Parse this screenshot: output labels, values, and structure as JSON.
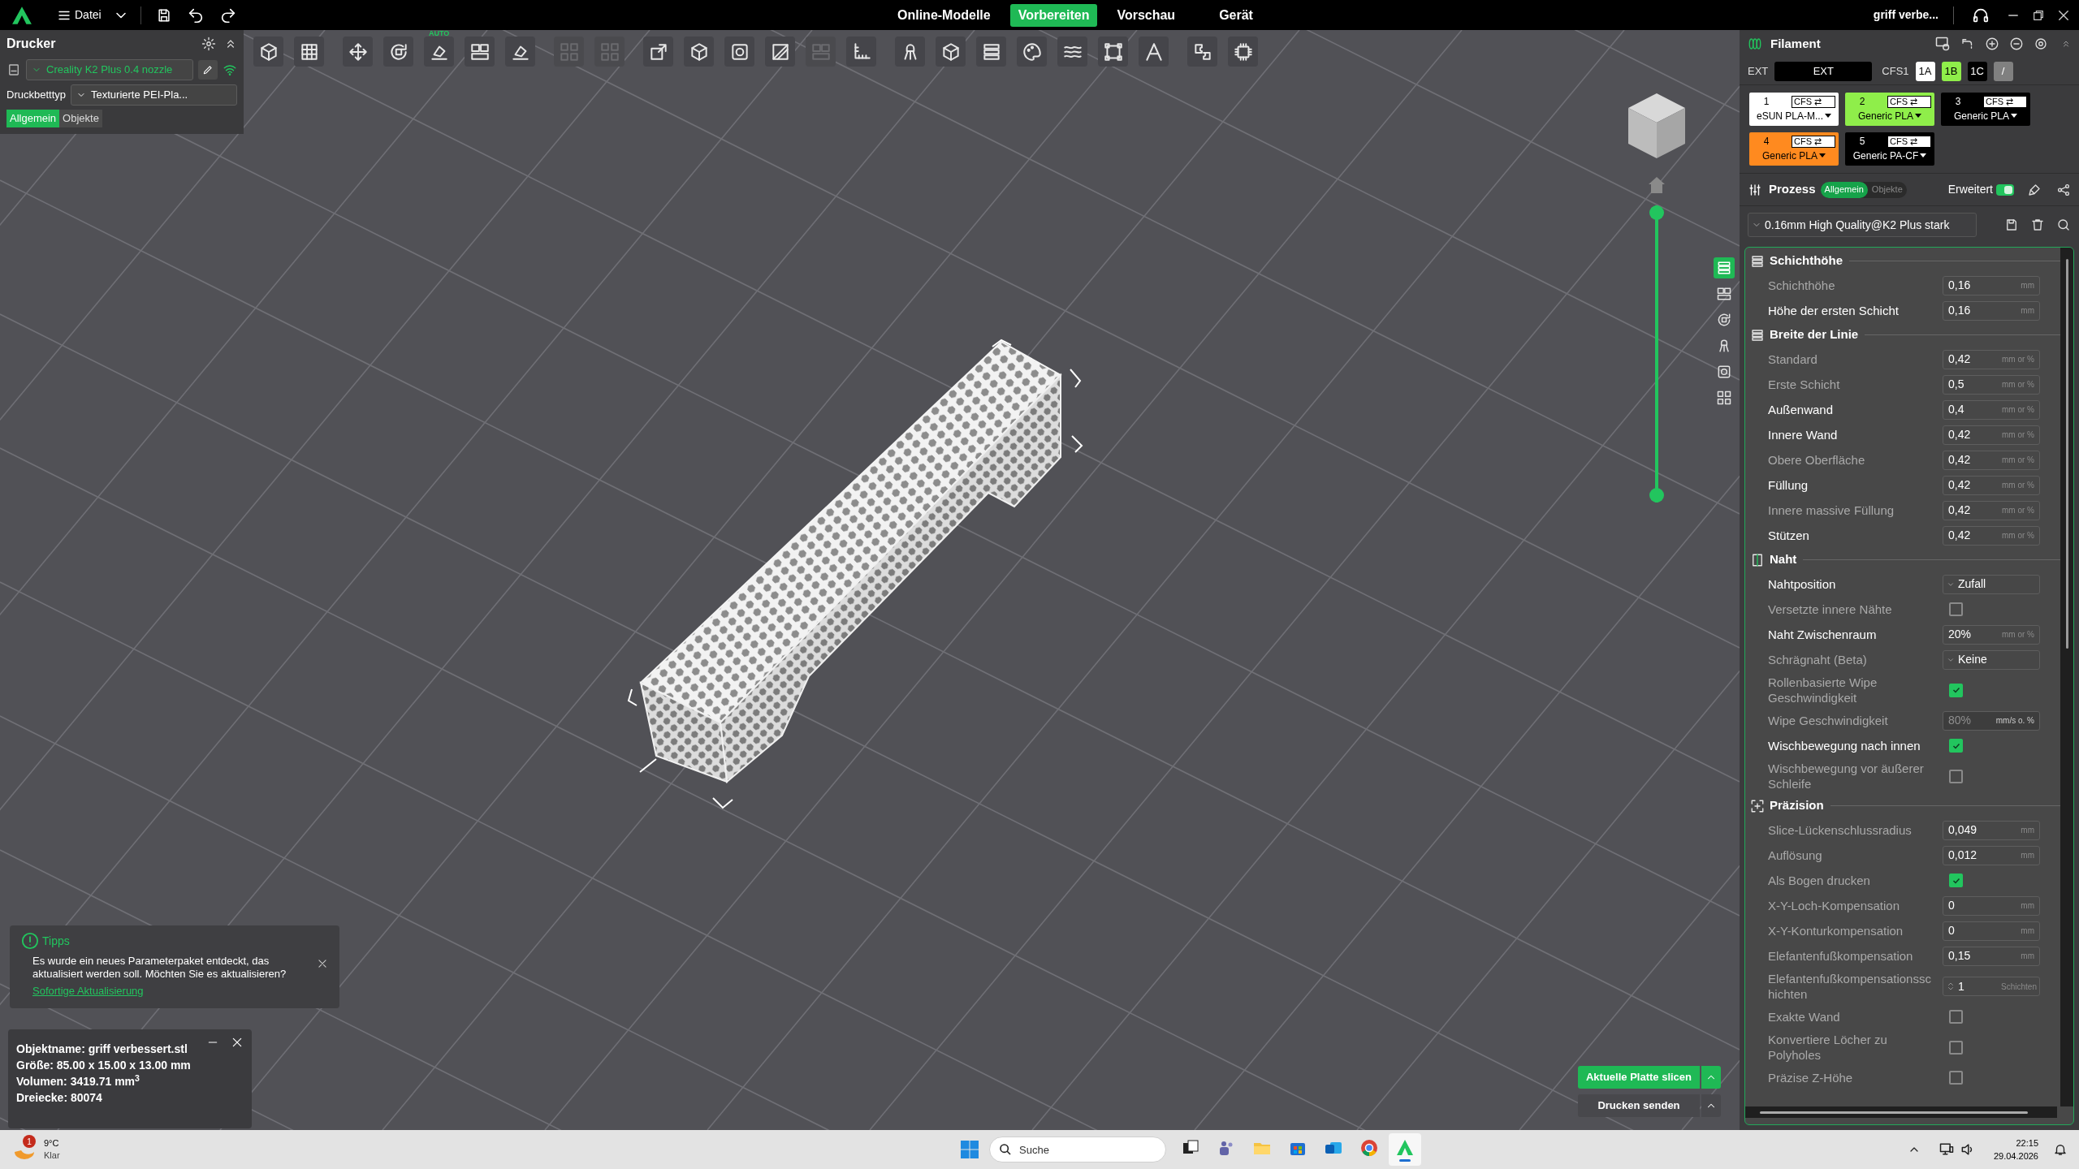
{
  "menu_bar": {
    "menu_label": "Datei",
    "tabs": [
      {
        "label": "Online-Modelle",
        "selected": false
      },
      {
        "label": "Vorbereiten",
        "selected": true
      },
      {
        "label": "Vorschau",
        "selected": false
      },
      {
        "label": "Gerät",
        "selected": false
      }
    ],
    "project_title": "griff verbe..."
  },
  "printer_panel": {
    "title": "Drucker",
    "printer": "Creality K2 Plus 0.4 nozzle",
    "bed_label": "Druckbetttyp",
    "bed_type": "Texturierte PEI-Pla...",
    "tabs": [
      {
        "label": "Allgemein",
        "selected": true
      },
      {
        "label": "Objekte",
        "selected": false
      }
    ]
  },
  "toolbar": [
    {
      "disabled": false
    },
    {
      "disabled": false
    },
    {
      "disabled": false
    },
    {
      "disabled": false
    },
    {
      "disabled": false,
      "badge": "AUTO"
    },
    {
      "disabled": false
    },
    {
      "disabled": false
    },
    {
      "disabled": true
    },
    {
      "disabled": true
    },
    {
      "disabled": false
    },
    {
      "disabled": false
    },
    {
      "disabled": false
    },
    {
      "disabled": false
    },
    {
      "disabled": true
    },
    {
      "disabled": false
    },
    {
      "disabled": false
    },
    {
      "disabled": false
    },
    {
      "disabled": false
    },
    {
      "disabled": false
    },
    {
      "disabled": false
    },
    {
      "disabled": false
    },
    {
      "disabled": false
    },
    {
      "disabled": false
    },
    {
      "disabled": false
    }
  ],
  "side_tools": [
    {
      "selected": true
    },
    {
      "selected": false
    },
    {
      "selected": false
    },
    {
      "selected": false
    },
    {
      "selected": false
    },
    {
      "selected": false
    }
  ],
  "layer_slider": {
    "thumbs": [
      {
        "level": 1
      },
      {
        "level": 0
      }
    ]
  },
  "tips": {
    "title": "Tipps",
    "message": "Es wurde ein neues Parameterpaket entdeckt, das aktualisiert werden soll. Möchten Sie es aktualisieren?",
    "link": "Sofortige Aktualisierung"
  },
  "object_info": {
    "lines": [
      "Objektname: griff verbessert.stl",
      "Größe: 85.00 x 15.00 x 13.00 mm",
      "Volumen: 3419.71 mm$^{3}$",
      "Dreiecke: 80074"
    ]
  },
  "slice_actions": {
    "slice": "Aktuelle Platte slicen",
    "send": "Drucken senden"
  },
  "filament_panel": {
    "title": "Filament",
    "ext_label": "EXT",
    "ext_value": "EXT",
    "cfs_label": "CFS1",
    "slots": [
      {
        "label": "1A",
        "color": "#ffffff"
      },
      {
        "label": "1B",
        "color": "#8fee4a"
      },
      {
        "label": "1C",
        "color": "#000000"
      },
      {
        "label": "/",
        "color": "#808080"
      }
    ],
    "filaments": [
      {
        "number": "1",
        "tag": "CFS ⇄",
        "name": "eSUN PLA-M...",
        "color": "#ffffff"
      },
      {
        "number": "2",
        "tag": "CFS ⇄",
        "name": "Generic PLA",
        "color": "#8fee4a"
      },
      {
        "number": "3",
        "tag": "CFS ⇄",
        "name": "Generic PLA",
        "color": "#000000"
      },
      {
        "number": "4",
        "tag": "CFS ⇄",
        "name": "Generic PLA",
        "color": "#ff8a1f"
      },
      {
        "number": "5",
        "tag": "CFS ⇄",
        "name": "Generic PA-CF",
        "color": "#000000"
      }
    ]
  },
  "process_panel": {
    "title": "Prozess",
    "tabs": [
      {
        "label": "Allgemein",
        "selected": true
      },
      {
        "label": "Objekte",
        "selected": false
      }
    ],
    "advanced": {
      "label": "Erweitert",
      "on": true
    },
    "preset": "0.16mm High Quality@K2 Plus stark"
  },
  "settings": [
    {
      "title": "Schichthöhe",
      "rows": [
        {
          "kind": "number",
          "label": "Schichthöhe",
          "value": "0,16",
          "unit": "mm",
          "highlighted": false,
          "disabled": false
        },
        {
          "kind": "number",
          "label": "Höhe der ersten Schicht",
          "value": "0,16",
          "unit": "mm",
          "highlighted": true,
          "disabled": false
        }
      ]
    },
    {
      "title": "Breite der Linie",
      "rows": [
        {
          "kind": "number",
          "label": "Standard",
          "value": "0,42",
          "unit": "mm or %",
          "highlighted": false,
          "disabled": false
        },
        {
          "kind": "number",
          "label": "Erste Schicht",
          "value": "0,5",
          "unit": "mm or %",
          "highlighted": false,
          "disabled": false
        },
        {
          "kind": "number",
          "label": "Außenwand",
          "value": "0,4",
          "unit": "mm or %",
          "highlighted": true,
          "disabled": false
        },
        {
          "kind": "number",
          "label": "Innere Wand",
          "value": "0,42",
          "unit": "mm or %",
          "highlighted": true,
          "disabled": false
        },
        {
          "kind": "number",
          "label": "Obere Oberfläche",
          "value": "0,42",
          "unit": "mm or %",
          "highlighted": false,
          "disabled": false
        },
        {
          "kind": "number",
          "label": "Füllung",
          "value": "0,42",
          "unit": "mm or %",
          "highlighted": true,
          "disabled": false
        },
        {
          "kind": "number",
          "label": "Innere massive Füllung",
          "value": "0,42",
          "unit": "mm or %",
          "highlighted": false,
          "disabled": false
        },
        {
          "kind": "number",
          "label": "Stützen",
          "value": "0,42",
          "unit": "mm or %",
          "highlighted": true,
          "disabled": false
        }
      ]
    },
    {
      "title": "Naht",
      "rows": [
        {
          "kind": "dropdown",
          "label": "Nahtposition",
          "value": "Zufall",
          "highlighted": true,
          "disabled": false
        },
        {
          "kind": "checkbox",
          "label": "Versetzte innere Nähte",
          "checked": false,
          "highlighted": false,
          "disabled": false
        },
        {
          "kind": "number",
          "label": "Naht Zwischenraum",
          "value": "20%",
          "unit": "mm or %",
          "highlighted": true,
          "disabled": false
        },
        {
          "kind": "dropdown",
          "label": "Schrägnaht (Beta)",
          "value": "Keine",
          "highlighted": false,
          "disabled": false
        },
        {
          "kind": "checkbox",
          "label": "Rollenbasierte Wipe Geschwindigkeit",
          "checked": true,
          "highlighted": false,
          "disabled": false
        },
        {
          "kind": "number",
          "label": "Wipe Geschwindigkeit",
          "value": "80%",
          "unit": "mm/s o. %",
          "highlighted": false,
          "disabled": true
        },
        {
          "kind": "checkbox",
          "label": "Wischbewegung nach innen",
          "checked": true,
          "highlighted": true,
          "disabled": false
        },
        {
          "kind": "checkbox",
          "label": "Wischbewegung vor äußerer Schleife",
          "checked": false,
          "highlighted": false,
          "disabled": false
        }
      ]
    },
    {
      "title": "Präzision",
      "rows": [
        {
          "kind": "number",
          "label": "Slice-Lückenschlussradius",
          "value": "0,049",
          "unit": "mm",
          "highlighted": false,
          "disabled": false
        },
        {
          "kind": "number",
          "label": "Auflösung",
          "value": "0,012",
          "unit": "mm",
          "highlighted": false,
          "disabled": false
        },
        {
          "kind": "checkbox",
          "label": "Als Bogen drucken",
          "checked": true,
          "highlighted": false,
          "disabled": false
        },
        {
          "kind": "number",
          "label": "X-Y-Loch-Kompensation",
          "value": "0",
          "unit": "mm",
          "highlighted": false,
          "disabled": false
        },
        {
          "kind": "number",
          "label": "X-Y-Konturkompensation",
          "value": "0",
          "unit": "mm",
          "highlighted": false,
          "disabled": false
        },
        {
          "kind": "number",
          "label": "Elefantenfußkompensation",
          "value": "0,15",
          "unit": "mm",
          "highlighted": false,
          "disabled": false
        },
        {
          "kind": "spinner",
          "label": "Elefantenfußkompensationsschichten",
          "value": "1",
          "unit": "Schichten",
          "highlighted": false,
          "disabled": false
        },
        {
          "kind": "checkbox",
          "label": "Exakte Wand",
          "checked": false,
          "highlighted": false,
          "disabled": false
        },
        {
          "kind": "checkbox",
          "label": "Konvertiere Löcher zu Polyholes",
          "checked": false,
          "highlighted": false,
          "disabled": false
        },
        {
          "kind": "checkbox",
          "label": "Präzise Z-Höhe",
          "checked": false,
          "highlighted": false,
          "disabled": false
        }
      ]
    }
  ],
  "taskbar": {
    "weather": {
      "temperature": "9°C",
      "condition": "Klar",
      "badge": "1"
    },
    "search_placeholder": "Suche",
    "apps": [
      {
        "active": false
      },
      {
        "active": false
      },
      {
        "active": false
      },
      {
        "active": false
      },
      {
        "active": false
      },
      {
        "active": false
      },
      {
        "active": true
      }
    ],
    "time": "22:15",
    "date": "29.04.2026"
  }
}
